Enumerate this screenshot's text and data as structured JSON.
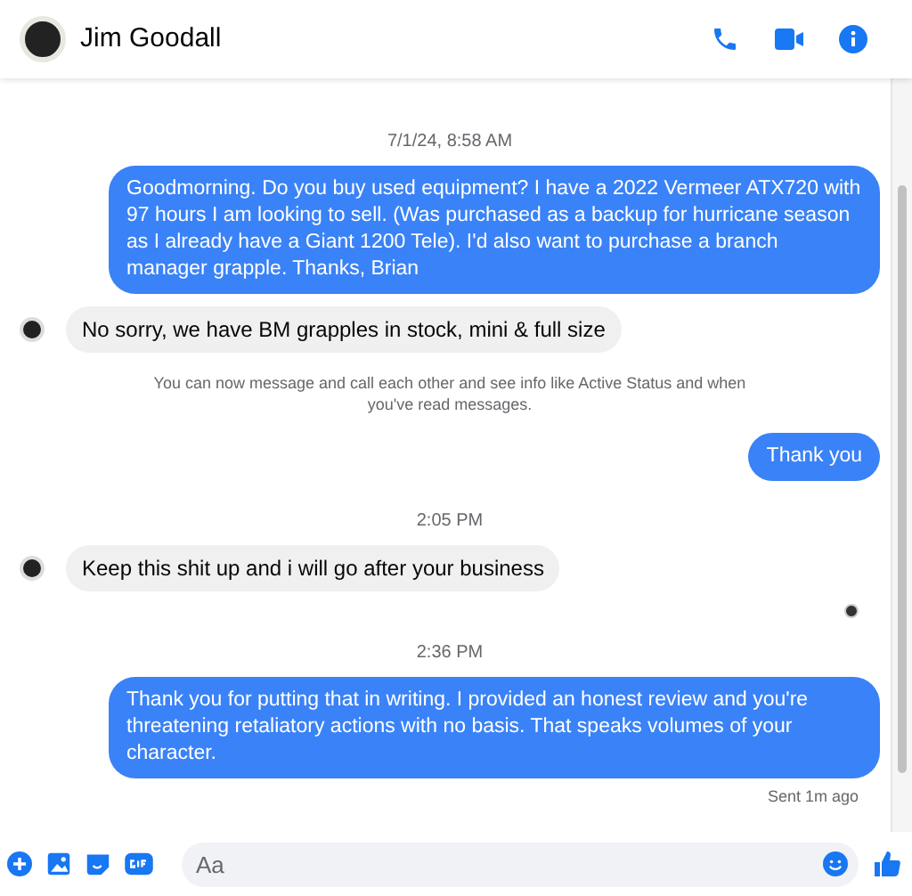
{
  "header": {
    "name": "Jim Goodall"
  },
  "messages": [
    {
      "kind": "timestamp",
      "text": "7/1/24, 8:58 AM"
    },
    {
      "kind": "sent",
      "text": "Goodmorning. Do you buy used equipment? I have a 2022 Vermeer ATX720 with 97 hours I am looking to sell. (Was purchased as a backup for hurricane season as I already have a Giant 1200 Tele). I'd also want to purchase a branch manager grapple. Thanks, Brian"
    },
    {
      "kind": "received",
      "text": "No sorry, we have BM grapples in stock, mini & full size"
    },
    {
      "kind": "notice",
      "text": "You can now message and call each other and see info like Active Status and when you've read messages."
    },
    {
      "kind": "sent",
      "text": "Thank you"
    },
    {
      "kind": "timestamp",
      "text": "2:05 PM"
    },
    {
      "kind": "received",
      "text": "Keep this shit up and i will go after your business"
    },
    {
      "kind": "seen"
    },
    {
      "kind": "timestamp",
      "text": "2:36 PM"
    },
    {
      "kind": "sent",
      "text": "Thank you for putting that in writing. I provided an honest review and you're threatening retaliatory actions with no basis. That speaks volumes of your character."
    },
    {
      "kind": "status",
      "text": "Sent 1m ago"
    }
  ],
  "composer": {
    "placeholder": "Aa"
  }
}
